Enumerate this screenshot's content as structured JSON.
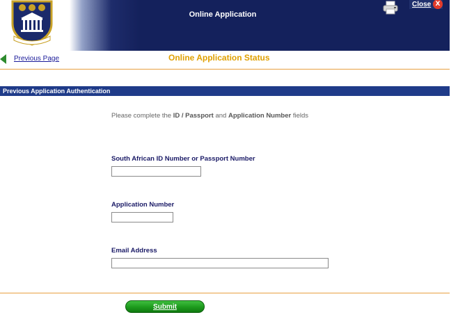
{
  "banner": {
    "title": "Online Application",
    "close_label": "Close",
    "close_icon": "X",
    "crest_icon": "university-crest-icon",
    "printer_icon": "printer-icon"
  },
  "nav": {
    "previous_page": "Previous Page",
    "page_title": "Online Application Status"
  },
  "section": {
    "title": "Previous Application Authentication"
  },
  "form": {
    "instruction_pre": "Please complete the ",
    "instruction_id": "ID / Passport",
    "instruction_mid": " and ",
    "instruction_app": "Application Number",
    "instruction_post": " fields",
    "id_label": "South African ID Number or Passport Number",
    "id_value": "",
    "app_label": "Application Number",
    "app_value": "",
    "email_label": "Email Address",
    "email_value": "",
    "submit_label": "Submit"
  },
  "colors": {
    "banner_navy": "#14215c",
    "section_blue": "#1f3b89",
    "title_orange": "#e0a000",
    "rule_orange": "#e8a040",
    "submit_green": "#1d9a1d",
    "close_red": "#e23a2a"
  }
}
